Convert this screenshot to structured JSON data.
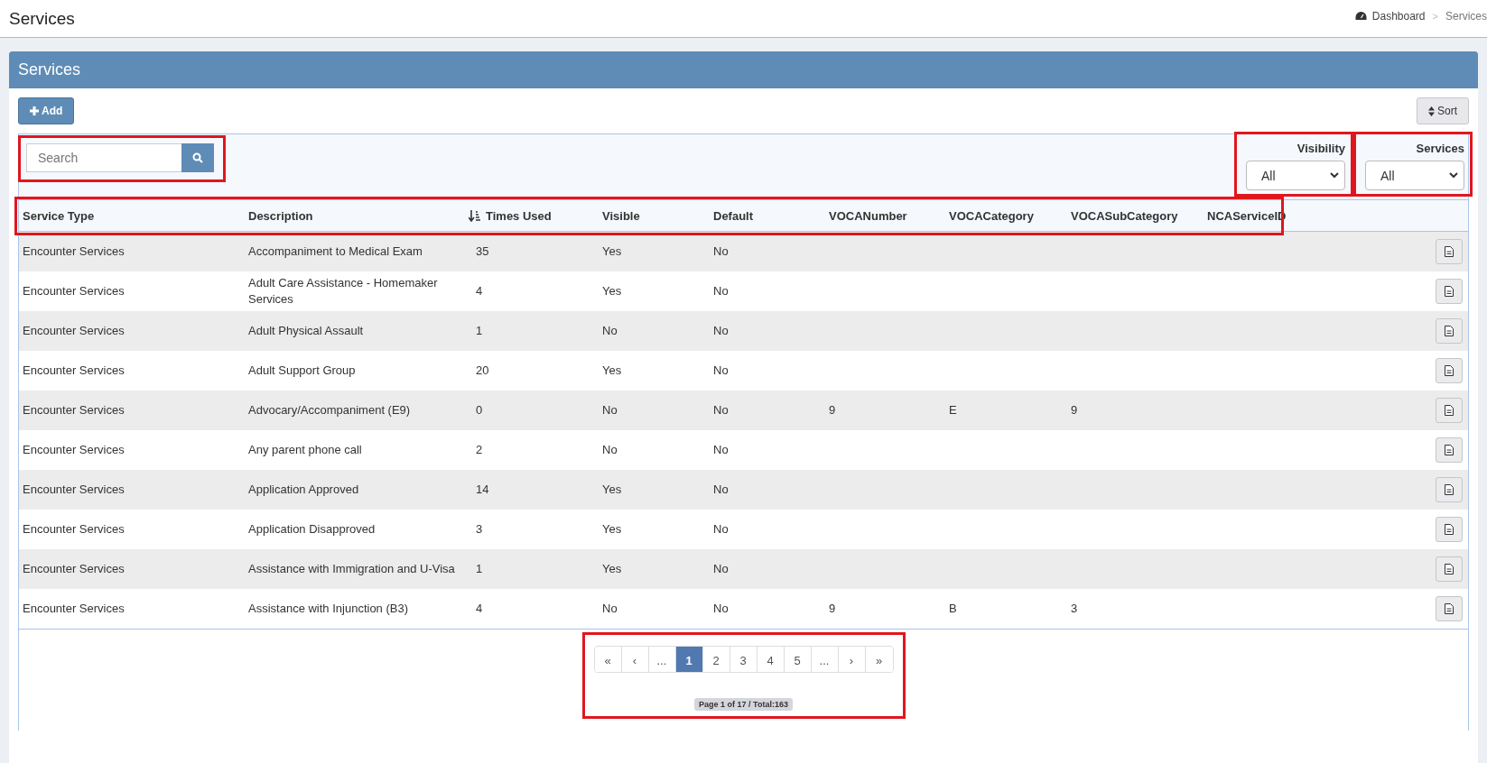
{
  "page_title": "Services",
  "breadcrumb": [
    {
      "label": "Dashboard",
      "kind": "link"
    },
    {
      "label": ">",
      "kind": "separator"
    },
    {
      "label": "Services",
      "kind": "current"
    }
  ],
  "panel": {
    "title": "Services",
    "add_button": "Add",
    "sort_button": "Sort"
  },
  "search": {
    "placeholder": "Search",
    "highlighted": true
  },
  "filters": [
    {
      "label": "Visibility",
      "value": "All",
      "highlighted": true
    },
    {
      "label": "Services",
      "value": "All",
      "highlighted": true
    }
  ],
  "table": {
    "header_highlighted": true,
    "columns": [
      {
        "label": "Service Type",
        "sorted": false
      },
      {
        "label": "Description",
        "sorted": false
      },
      {
        "label": "Times Used",
        "sorted": true
      },
      {
        "label": "Visible",
        "sorted": false
      },
      {
        "label": "Default",
        "sorted": false
      },
      {
        "label": "VOCANumber",
        "sorted": false
      },
      {
        "label": "VOCACategory",
        "sorted": false
      },
      {
        "label": "VOCASubCategory",
        "sorted": false
      },
      {
        "label": "NCAServiceID",
        "sorted": false
      }
    ],
    "rows": [
      [
        "Encounter Services",
        "Accompaniment to Medical Exam",
        "35",
        "Yes",
        "No",
        "",
        "",
        "",
        ""
      ],
      [
        "Encounter Services",
        "Adult Care Assistance - Homemaker Services",
        "4",
        "Yes",
        "No",
        "",
        "",
        "",
        ""
      ],
      [
        "Encounter Services",
        "Adult Physical Assault",
        "1",
        "No",
        "No",
        "",
        "",
        "",
        ""
      ],
      [
        "Encounter Services",
        "Adult Support Group",
        "20",
        "Yes",
        "No",
        "",
        "",
        "",
        ""
      ],
      [
        "Encounter Services",
        "Advocary/Accompaniment (E9)",
        "0",
        "No",
        "No",
        "9",
        "E",
        "9",
        ""
      ],
      [
        "Encounter Services",
        "Any parent phone call",
        "2",
        "No",
        "No",
        "",
        "",
        "",
        ""
      ],
      [
        "Encounter Services",
        "Application Approved",
        "14",
        "Yes",
        "No",
        "",
        "",
        "",
        ""
      ],
      [
        "Encounter Services",
        "Application Disapproved",
        "3",
        "Yes",
        "No",
        "",
        "",
        "",
        ""
      ],
      [
        "Encounter Services",
        "Assistance with Immigration and U-Visa",
        "1",
        "Yes",
        "No",
        "",
        "",
        "",
        ""
      ],
      [
        "Encounter Services",
        "Assistance with Injunction (B3)",
        "4",
        "No",
        "No",
        "9",
        "B",
        "3",
        ""
      ]
    ]
  },
  "pagination": {
    "highlighted": true,
    "pages": [
      {
        "label": "«",
        "selected": false
      },
      {
        "label": "‹",
        "selected": false
      },
      {
        "label": "...",
        "selected": false
      },
      {
        "label": "1",
        "selected": true
      },
      {
        "label": "2",
        "selected": false
      },
      {
        "label": "3",
        "selected": false
      },
      {
        "label": "4",
        "selected": false
      },
      {
        "label": "5",
        "selected": false
      },
      {
        "label": "...",
        "selected": false
      },
      {
        "label": "›",
        "selected": false
      },
      {
        "label": "»",
        "selected": false
      }
    ],
    "summary": "Page 1 of 17 / Total:163"
  }
}
